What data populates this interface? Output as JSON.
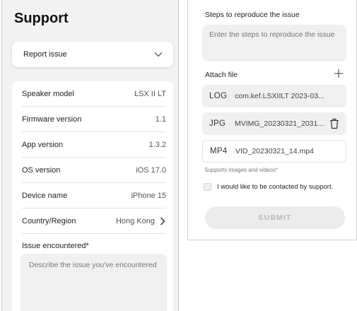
{
  "left": {
    "title": "Support",
    "report_dropdown": {
      "selected": "Report issue"
    },
    "info_rows": [
      {
        "label": "Speaker model",
        "value": "LSX II LT"
      },
      {
        "label": "Firmware version",
        "value": "1.1"
      },
      {
        "label": "App version",
        "value": "1.3.2"
      },
      {
        "label": "OS version",
        "value": "iOS 17.0"
      },
      {
        "label": "Device name",
        "value": "iPhone 15"
      },
      {
        "label": "Country/Region",
        "value": "Hong Kong"
      }
    ],
    "issue_label": "Issue encountered*",
    "issue_placeholder": "Describe the issue you've encountered"
  },
  "right": {
    "steps_label": "Steps to reproduce the issue",
    "steps_placeholder": "Enter the steps to reproduce the issue",
    "attach_label": "Attach file",
    "files": [
      {
        "type": "LOG",
        "name": "com.kef.LSXIILT 2023-03..."
      },
      {
        "type": "JPG",
        "name": "MVIMG_20230321_2031..."
      },
      {
        "type": "MP4",
        "name": "VID_20230321_14.mp4"
      }
    ],
    "supports_text": "Supports images and videos*",
    "contact_label": "I would like to be contacted by support.",
    "submit_label": "SUBMIT"
  },
  "colors": {
    "panel_bg": "#f2f2f2",
    "card_bg": "#ffffff",
    "field_bg": "#f0f0f0",
    "submit_text": "#b9b9b9"
  },
  "icons": [
    "chevron-down-icon",
    "chevron-right-icon",
    "plus-icon",
    "trash-icon"
  ]
}
